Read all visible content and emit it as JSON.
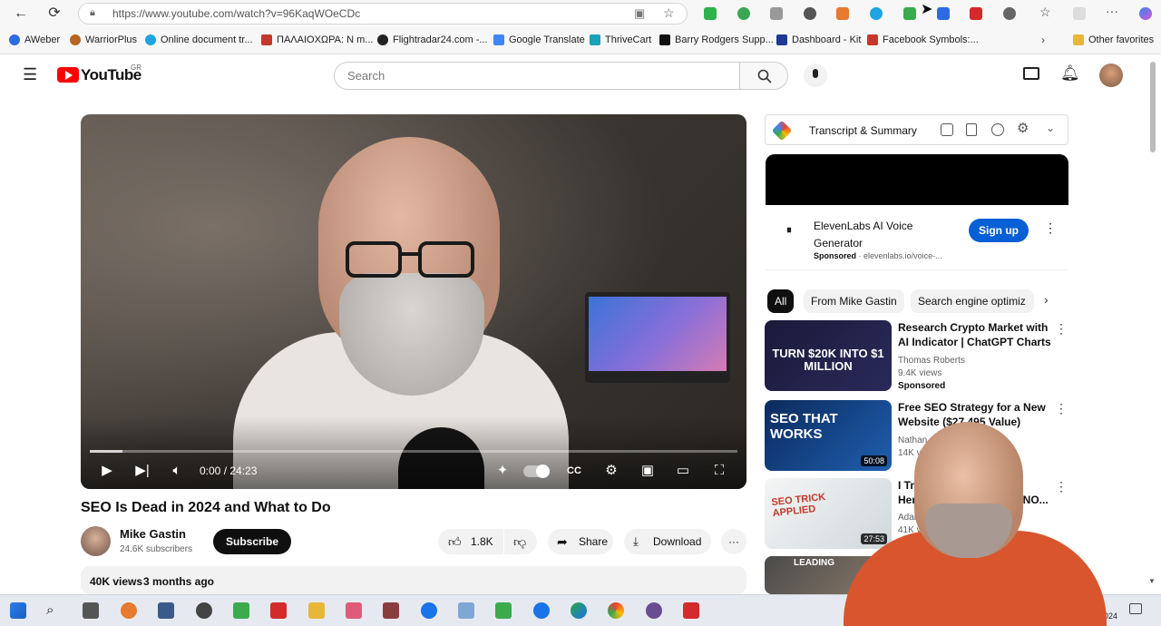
{
  "browser": {
    "url": "https://www.youtube.com/watch?v=96KaqWOeCDc",
    "bookmarks": [
      "AWeber",
      "WarriorPlus",
      "Online document tr...",
      "ΠΑΛΑΙΟΧΩΡΑ: N m...",
      "Flightradar24.com -...",
      "Google Translate",
      "ThriveCart",
      "Barry Rodgers Supp...",
      "Dashboard - Kit",
      "Facebook Symbols:..."
    ],
    "other_favorites": "Other favorites"
  },
  "header": {
    "logo_text": "YouTube",
    "region": "GR",
    "search_placeholder": "Search"
  },
  "player": {
    "time": "0:00 / 24:23",
    "progress": 0.05
  },
  "video": {
    "title": "SEO Is Dead in 2024 and What to Do",
    "channel": "Mike Gastin",
    "subscribers": "24.6K subscribers",
    "subscribe_label": "Subscribe",
    "likes": "1.8K",
    "share_label": "Share",
    "download_label": "Download",
    "views": "40K views",
    "age": "3 months ago"
  },
  "sidebar": {
    "extension_title": "Transcript & Summary",
    "ad": {
      "title_line1": "ElevenLabs AI Voice",
      "title_line2": "Generator",
      "sponsored": "Sponsored",
      "domain": "elevenlabs.io/voice-...",
      "cta": "Sign up"
    },
    "chips": [
      "All",
      "From Mike Gastin",
      "Search engine optimiz"
    ],
    "videos": [
      {
        "title": "Research Crypto Market with AI Indicator | ChatGPT Charts",
        "channel": "Thomas Roberts",
        "views": "9.4K views",
        "badge": "Sponsored",
        "thumb_text": "TURN $20K INTO $1 MILLION"
      },
      {
        "title": "Free SEO Strategy for a New Website ($27,495 Value)",
        "channel": "Nathan Gotch",
        "views": "14K views",
        "duration": "50:08",
        "thumb_text": "SEO THAT WORKS"
      },
      {
        "title": "I Tried... Here's...",
        "channel": "Adam E",
        "views": "41K views",
        "duration": "27:53",
        "thumb_text": "SEO TRICK APPLIED",
        "title_tail": "T NO..."
      },
      {
        "thumb_text": "LEADING"
      }
    ]
  },
  "taskbar": {
    "clock_time": "5",
    "clock_date": "2024"
  },
  "colors": {
    "yt_red": "#ff0000",
    "link_blue": "#065fd4",
    "subscribe_bg": "#0f0f0f",
    "taskbar_bg": "#e6eaf0"
  }
}
